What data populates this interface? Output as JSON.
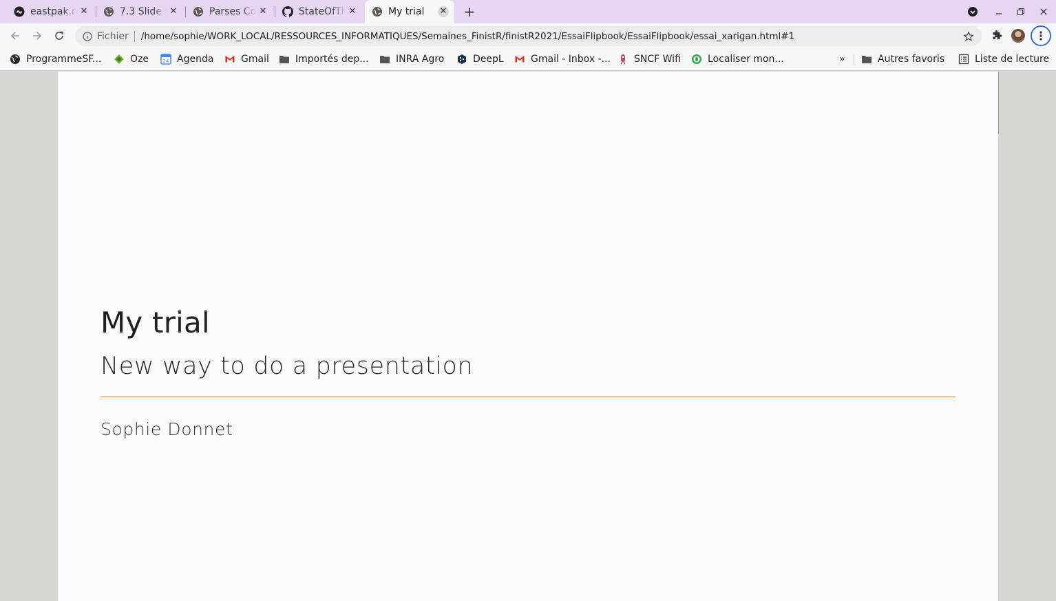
{
  "browser": {
    "tabs": [
      {
        "label": "eastpak.n",
        "icon": "eastpak-logo-icon"
      },
      {
        "label": "7.3 Slide f",
        "icon": "globe-icon"
      },
      {
        "label": "Parses Co",
        "icon": "globe-icon"
      },
      {
        "label": "StateOfTh",
        "icon": "github-icon"
      },
      {
        "label": "My trial",
        "icon": "globe-icon",
        "active": true
      }
    ],
    "new_tab_symbol": "+",
    "close_symbol": "✕",
    "address": {
      "scheme_label": "Fichier",
      "url": "/home/sophie/WORK_LOCAL/RESSOURCES_INFORMATIQUES/Semaines_FinistR/finistR2021/EssaiFlipbook/EssaiFlipbook/essai_xarigan.html#1"
    },
    "bookmarks": [
      {
        "label": "ProgrammeSF...",
        "icon": "globe-dark-icon"
      },
      {
        "label": "Oze",
        "icon": "oze-icon"
      },
      {
        "label": "Agenda",
        "icon": "calendar-icon"
      },
      {
        "label": "Gmail",
        "icon": "gmail-icon"
      },
      {
        "label": "Importés dep...",
        "icon": "folder-icon"
      },
      {
        "label": "INRA Agro",
        "icon": "folder-icon"
      },
      {
        "label": "DeepL",
        "icon": "deepl-icon"
      },
      {
        "label": "Gmail - Inbox -...",
        "icon": "gmail-icon"
      },
      {
        "label": "SNCF Wifi",
        "icon": "sncf-icon"
      },
      {
        "label": "Localiser mon...",
        "icon": "locate-icon"
      }
    ],
    "bookmarks_overflow": "»",
    "other_bookmarks": {
      "label": "Autres favoris",
      "icon": "folder-icon"
    },
    "reading_list": {
      "label": "Liste de lecture",
      "icon": "reading-list-icon"
    },
    "colors": {
      "tabstrip": "#e6d6f4",
      "toolbar": "#f7f7f7",
      "accent_rule": "#e07b1c"
    }
  },
  "slide": {
    "title": "My trial",
    "subtitle": "New way to do a presentation",
    "author": "Sophie Donnet"
  }
}
